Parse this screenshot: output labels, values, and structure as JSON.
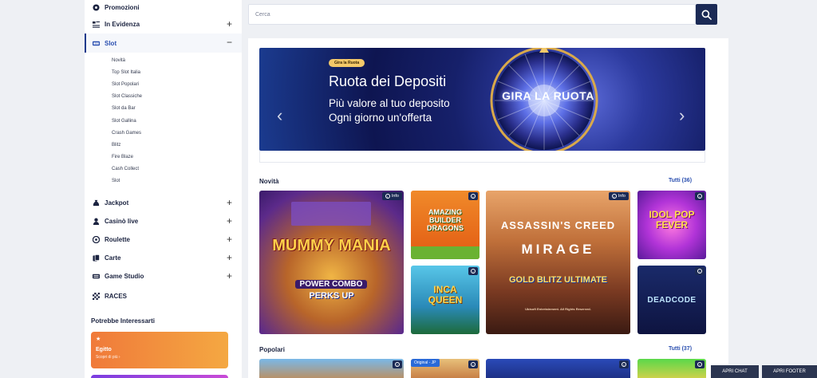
{
  "sidebar": {
    "promozioni": "Promozioni",
    "in_evidenza": "In Evidenza",
    "slot": "Slot",
    "slot_children": [
      "Novità",
      "Top Slot Italia",
      "Slot Popolari",
      "Slot Classiche",
      "Slot da Bar",
      "Slot Gallina",
      "Crash Games",
      "Blitz",
      "Fire Blaze",
      "Cash Collect",
      "Slot"
    ],
    "jackpot": "Jackpot",
    "casino_live": "Casinò live",
    "roulette": "Roulette",
    "carte": "Carte",
    "game_studio": "Game Studio",
    "races": "RACES",
    "plus": "+",
    "minus": "−",
    "suggest_title": "Potrebbe Interessarti",
    "suggest_card_title": "Egitto",
    "suggest_card_sub": "Scopri di più ›"
  },
  "search": {
    "placeholder": "Cerca"
  },
  "banner": {
    "pill": "Gira la Ruota",
    "title": "Ruota dei Depositi",
    "line1": "Più valore al tuo deposito",
    "line2": "Ogni giorno un'offerta",
    "wheel_text": "GIRA LA RUOTA",
    "prev": "‹",
    "next": "›"
  },
  "sections": {
    "novita": {
      "title": "Novità",
      "all": "Tutti (36)"
    },
    "popolari": {
      "title": "Popolari",
      "all": "Tutti (37)"
    }
  },
  "tiles": {
    "info_label": "Info",
    "mummy": "MUMMY MANIA",
    "mummy_sub": "POWER COMBO",
    "mummy_sub2": "PERKS UP",
    "amazing": "AMAZING BUILDER DRAGONS",
    "inca": "INCA QUEEN",
    "assassin": "ASSASSIN'S CREED",
    "assassin_2": "MIRAGE",
    "assassin_3": "GOLD BLITZ ULTIMATE",
    "assassin_credit": "Ubisoft Entertainment. All Rights Reserved.",
    "idol": "IDOL POP FEVER",
    "deadcode": "DEADCODE",
    "original_badge": "Original - JP"
  },
  "footer": {
    "chat": "APRI CHAT",
    "footer": "APRI FOOTER"
  },
  "colors": {
    "navy": "#1b2a55",
    "accent": "#2a4fb0"
  }
}
